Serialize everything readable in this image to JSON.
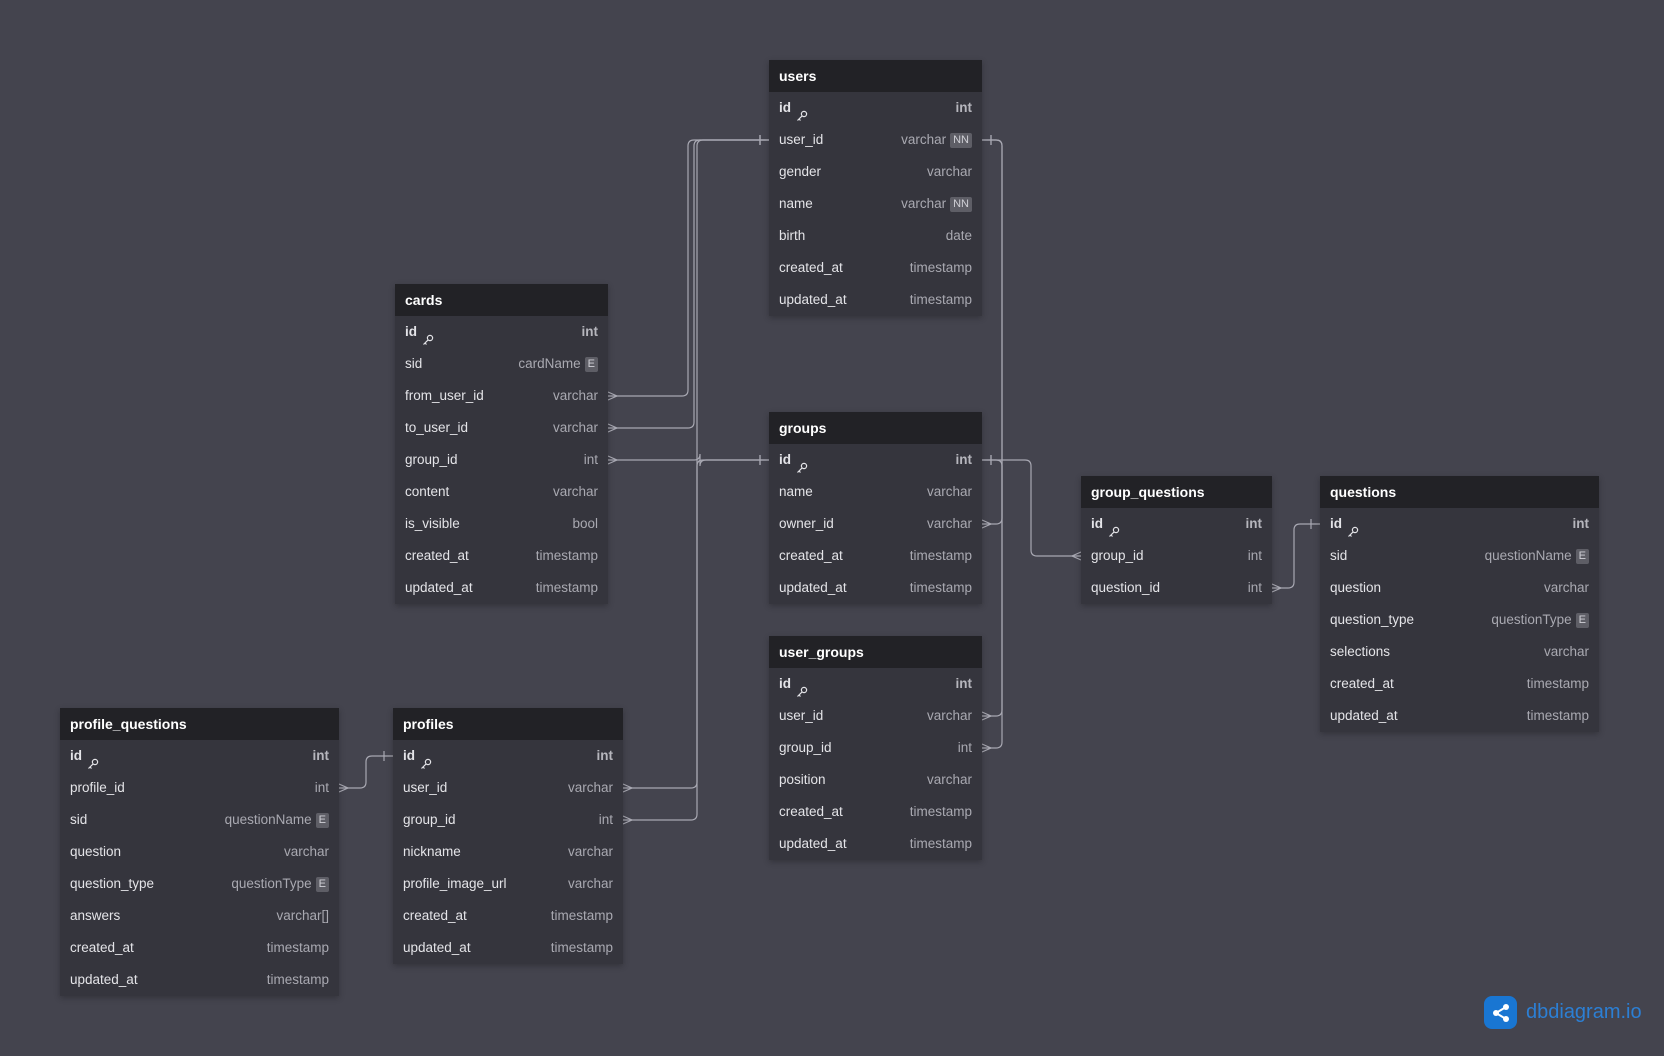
{
  "brand": {
    "text": "dbdiagram.io"
  },
  "tables": [
    {
      "name": "users",
      "fields": [
        {
          "name": "id",
          "type": "int",
          "pk": true
        },
        {
          "name": "user_id",
          "type": "varchar",
          "badge": "NN"
        },
        {
          "name": "gender",
          "type": "varchar"
        },
        {
          "name": "name",
          "type": "varchar",
          "badge": "NN"
        },
        {
          "name": "birth",
          "type": "date"
        },
        {
          "name": "created_at",
          "type": "timestamp"
        },
        {
          "name": "updated_at",
          "type": "timestamp"
        }
      ]
    },
    {
      "name": "cards",
      "fields": [
        {
          "name": "id",
          "type": "int",
          "pk": true
        },
        {
          "name": "sid",
          "type": "cardName",
          "badge": "E"
        },
        {
          "name": "from_user_id",
          "type": "varchar"
        },
        {
          "name": "to_user_id",
          "type": "varchar"
        },
        {
          "name": "group_id",
          "type": "int"
        },
        {
          "name": "content",
          "type": "varchar"
        },
        {
          "name": "is_visible",
          "type": "bool"
        },
        {
          "name": "created_at",
          "type": "timestamp"
        },
        {
          "name": "updated_at",
          "type": "timestamp"
        }
      ]
    },
    {
      "name": "groups",
      "fields": [
        {
          "name": "id",
          "type": "int",
          "pk": true
        },
        {
          "name": "name",
          "type": "varchar"
        },
        {
          "name": "owner_id",
          "type": "varchar"
        },
        {
          "name": "created_at",
          "type": "timestamp"
        },
        {
          "name": "updated_at",
          "type": "timestamp"
        }
      ]
    },
    {
      "name": "group_questions",
      "fields": [
        {
          "name": "id",
          "type": "int",
          "pk": true
        },
        {
          "name": "group_id",
          "type": "int"
        },
        {
          "name": "question_id",
          "type": "int"
        }
      ]
    },
    {
      "name": "questions",
      "fields": [
        {
          "name": "id",
          "type": "int",
          "pk": true
        },
        {
          "name": "sid",
          "type": "questionName",
          "badge": "E"
        },
        {
          "name": "question",
          "type": "varchar"
        },
        {
          "name": "question_type",
          "type": "questionType",
          "badge": "E"
        },
        {
          "name": "selections",
          "type": "varchar"
        },
        {
          "name": "created_at",
          "type": "timestamp"
        },
        {
          "name": "updated_at",
          "type": "timestamp"
        }
      ]
    },
    {
      "name": "user_groups",
      "fields": [
        {
          "name": "id",
          "type": "int",
          "pk": true
        },
        {
          "name": "user_id",
          "type": "varchar"
        },
        {
          "name": "group_id",
          "type": "int"
        },
        {
          "name": "position",
          "type": "varchar"
        },
        {
          "name": "created_at",
          "type": "timestamp"
        },
        {
          "name": "updated_at",
          "type": "timestamp"
        }
      ]
    },
    {
      "name": "profile_questions",
      "fields": [
        {
          "name": "id",
          "type": "int",
          "pk": true
        },
        {
          "name": "profile_id",
          "type": "int"
        },
        {
          "name": "sid",
          "type": "questionName",
          "badge": "E"
        },
        {
          "name": "question",
          "type": "varchar"
        },
        {
          "name": "question_type",
          "type": "questionType",
          "badge": "E"
        },
        {
          "name": "answers",
          "type": "varchar[]"
        },
        {
          "name": "created_at",
          "type": "timestamp"
        },
        {
          "name": "updated_at",
          "type": "timestamp"
        }
      ]
    },
    {
      "name": "profiles",
      "fields": [
        {
          "name": "id",
          "type": "int",
          "pk": true
        },
        {
          "name": "user_id",
          "type": "varchar"
        },
        {
          "name": "group_id",
          "type": "int"
        },
        {
          "name": "nickname",
          "type": "varchar"
        },
        {
          "name": "profile_image_url",
          "type": "varchar"
        },
        {
          "name": "created_at",
          "type": "timestamp"
        },
        {
          "name": "updated_at",
          "type": "timestamp"
        }
      ]
    }
  ],
  "relationships": [
    {
      "from": "cards.from_user_id",
      "to": "users.user_id",
      "cardinality": "many-to-one"
    },
    {
      "from": "cards.to_user_id",
      "to": "users.user_id",
      "cardinality": "many-to-one"
    },
    {
      "from": "cards.group_id",
      "to": "groups.id",
      "cardinality": "many-to-one"
    },
    {
      "from": "profiles.user_id",
      "to": "users.user_id",
      "cardinality": "many-to-one"
    },
    {
      "from": "profiles.group_id",
      "to": "groups.id",
      "cardinality": "many-to-one"
    },
    {
      "from": "groups.owner_id",
      "to": "users.user_id",
      "cardinality": "many-to-one"
    },
    {
      "from": "user_groups.user_id",
      "to": "users.user_id",
      "cardinality": "many-to-one"
    },
    {
      "from": "user_groups.group_id",
      "to": "groups.id",
      "cardinality": "many-to-one"
    },
    {
      "from": "group_questions.group_id",
      "to": "groups.id",
      "cardinality": "many-to-one"
    },
    {
      "from": "group_questions.question_id",
      "to": "questions.id",
      "cardinality": "many-to-one"
    },
    {
      "from": "profile_questions.profile_id",
      "to": "profiles.id",
      "cardinality": "many-to-one"
    }
  ],
  "colors": {
    "canvas": "#44444e",
    "table_header": "#222226",
    "table_body": "#35353d",
    "edge": "#a8a8b2",
    "brand": "#1976d2"
  }
}
